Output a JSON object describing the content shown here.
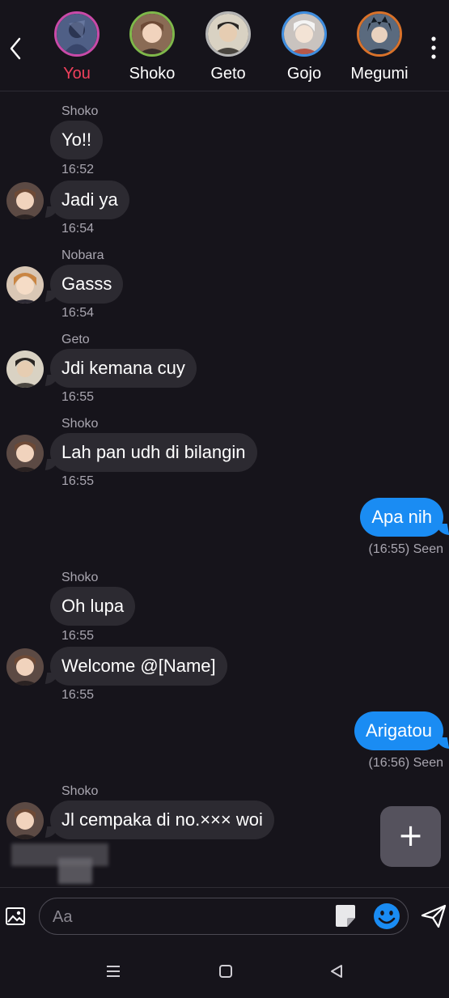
{
  "header": {
    "members": [
      {
        "name": "You",
        "ring": "#c94aa8",
        "tone": "#5a6b93"
      },
      {
        "name": "Shoko",
        "ring": "#7fb84a",
        "tone": "#c9a27a"
      },
      {
        "name": "Geto",
        "ring": "#b6b6b6",
        "tone": "#7a7466"
      },
      {
        "name": "Gojo",
        "ring": "#3f8ee0",
        "tone": "#e9e4df"
      },
      {
        "name": "Megumi",
        "ring": "#d9722a",
        "tone": "#3a4a66"
      }
    ]
  },
  "messages": {
    "m1": {
      "sender": "Shoko",
      "text": "Yo!!",
      "time": "16:52"
    },
    "m2": {
      "text": "Jadi ya",
      "time": "16:54"
    },
    "m3": {
      "sender": "Nobara",
      "text": "Gasss",
      "time": "16:54"
    },
    "m4": {
      "sender": "Geto",
      "text": "Jdi kemana cuy",
      "time": "16:55"
    },
    "m5": {
      "sender": "Shoko",
      "text": "Lah pan udh di bilangin",
      "time": "16:55"
    },
    "m6": {
      "text": "Apa nih",
      "status": "(16:55) Seen"
    },
    "m7": {
      "sender": "Shoko",
      "text": "Oh lupa",
      "time": "16:55"
    },
    "m8": {
      "text": "Welcome @[Name]",
      "time": "16:55"
    },
    "m9": {
      "text": "Arigatou",
      "status": "(16:56) Seen"
    },
    "m10": {
      "sender": "Shoko",
      "text": "Jl cempaka di no.××× woi"
    }
  },
  "composer": {
    "placeholder": "Aa"
  },
  "colors": {
    "accent": "#1a8cf3",
    "you": "#f0405c",
    "bubble": "#2c2a31",
    "background": "#16141b"
  }
}
